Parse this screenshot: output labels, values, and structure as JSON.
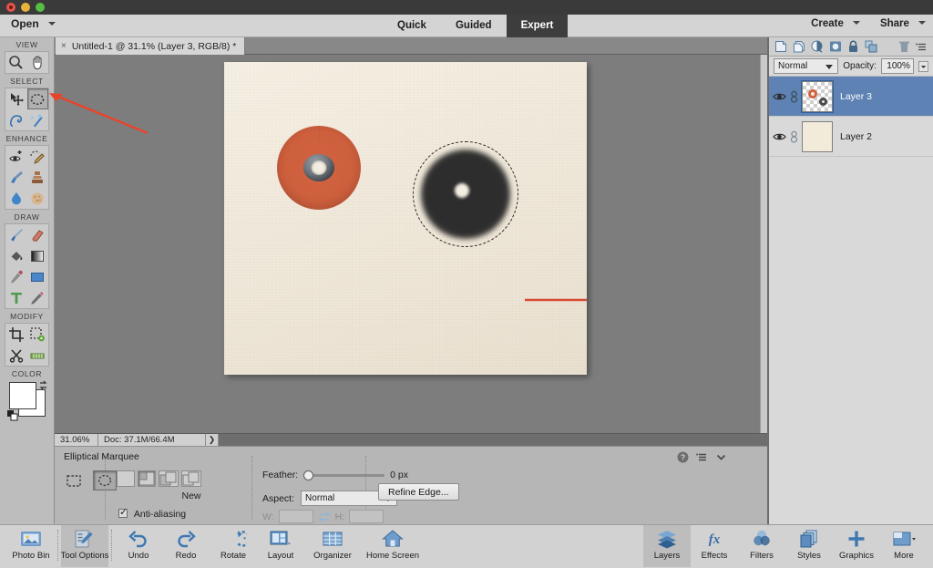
{
  "window": {
    "traffic_lights": [
      "close",
      "minimize",
      "maximize"
    ]
  },
  "menubar": {
    "open_label": "Open",
    "modes": [
      {
        "label": "Quick",
        "active": false
      },
      {
        "label": "Guided",
        "active": false
      },
      {
        "label": "Expert",
        "active": true
      }
    ],
    "right_menus": [
      {
        "label": "Create"
      },
      {
        "label": "Share"
      }
    ]
  },
  "document_tab": {
    "close_glyph": "×",
    "title": "Untitled-1 @ 31.1% (Layer 3, RGB/8) *"
  },
  "toolbar": {
    "groups": [
      {
        "label": "VIEW",
        "tools": [
          {
            "name": "zoom-tool",
            "icon": "magnifier-icon",
            "active": false
          },
          {
            "name": "hand-tool",
            "icon": "hand-icon",
            "active": false
          }
        ]
      },
      {
        "label": "SELECT",
        "tools": [
          {
            "name": "move-tool",
            "icon": "move-arrow-icon",
            "active": false
          },
          {
            "name": "elliptical-marquee-tool",
            "icon": "ellipse-marquee-icon",
            "active": true
          },
          {
            "name": "lasso-tool",
            "icon": "lasso-icon",
            "active": false
          },
          {
            "name": "quick-selection-tool",
            "icon": "magic-wand-icon",
            "active": false
          }
        ]
      },
      {
        "label": "ENHANCE",
        "tools": [
          {
            "name": "red-eye-tool",
            "icon": "eye-icon",
            "active": false
          },
          {
            "name": "spot-healing-tool",
            "icon": "healing-brush-icon",
            "active": false
          },
          {
            "name": "smart-brush-tool",
            "icon": "paintbrush-blue-icon",
            "active": false
          },
          {
            "name": "clone-stamp-tool",
            "icon": "stamp-icon",
            "active": false
          },
          {
            "name": "blur-tool",
            "icon": "waterdrop-icon",
            "active": false
          },
          {
            "name": "sponge-tool",
            "icon": "sponge-icon",
            "active": false
          }
        ]
      },
      {
        "label": "DRAW",
        "tools": [
          {
            "name": "brush-tool",
            "icon": "brush-icon",
            "active": false
          },
          {
            "name": "eraser-tool",
            "icon": "eraser-icon",
            "active": false
          },
          {
            "name": "paint-bucket-tool",
            "icon": "paint-bucket-icon",
            "active": false
          },
          {
            "name": "gradient-tool",
            "icon": "gradient-icon",
            "active": false
          },
          {
            "name": "eyedropper-tool",
            "icon": "eyedropper-icon",
            "active": false
          },
          {
            "name": "shape-tool",
            "icon": "rectangle-shape-icon",
            "active": false
          },
          {
            "name": "type-tool",
            "icon": "type-t-icon",
            "active": false
          },
          {
            "name": "pencil-tool",
            "icon": "pencil-icon",
            "active": false
          }
        ]
      },
      {
        "label": "MODIFY",
        "tools": [
          {
            "name": "crop-tool",
            "icon": "crop-icon",
            "active": false
          },
          {
            "name": "content-aware-move-tool",
            "icon": "cookie-cutter-icon",
            "active": false
          },
          {
            "name": "recompose-tool",
            "icon": "scissors-icon",
            "active": false
          },
          {
            "name": "straighten-tool",
            "icon": "straighten-icon",
            "active": false
          }
        ]
      },
      {
        "label": "COLOR",
        "tools": []
      }
    ],
    "color": {
      "foreground": "#ffffff",
      "background": "#ffffff",
      "swap_icon": "swap-colors-icon",
      "default_icon": "default-colors-icon"
    }
  },
  "canvas": {
    "background_color": "#7d7d7d",
    "paper_color": "#f2ece0",
    "objects": [
      {
        "name": "orange-disc",
        "color": "#d2613f",
        "description": "orange felt disc with metal grommet"
      },
      {
        "name": "dark-blurred-disc",
        "color": "#2d2d2d",
        "description": "blurred dark circle with light center"
      },
      {
        "name": "elliptical-selection",
        "description": "marching ants elliptical selection"
      }
    ],
    "annotations": [
      {
        "name": "canvas-red-arrow",
        "color": "#d94a34",
        "points_to": "dark-blurred-disc"
      },
      {
        "name": "toolbar-red-arrow",
        "color": "#e8442c",
        "points_to": "elliptical-marquee-tool"
      }
    ]
  },
  "statusbar": {
    "zoom": "31.06%",
    "doc_info": "Doc: 37.1M/66.4M",
    "expand_glyph": "❯"
  },
  "tool_options": {
    "title": "Elliptical Marquee",
    "shape_buttons": [
      {
        "name": "rectangular-marquee",
        "icon": "rect-marquee-icon",
        "active": false
      },
      {
        "name": "elliptical-marquee",
        "icon": "ellipse-marquee-icon",
        "active": true
      }
    ],
    "mode_buttons": [
      {
        "name": "new-selection",
        "active": false
      },
      {
        "name": "add-to-selection",
        "active": true
      },
      {
        "name": "subtract-from-selection",
        "active": false
      },
      {
        "name": "intersect-with-selection",
        "active": false
      }
    ],
    "mode_label": "New",
    "antialias_label": "Anti-aliasing",
    "antialias_checked": true,
    "feather_label": "Feather:",
    "feather_value": "0 px",
    "aspect_label": "Aspect:",
    "aspect_value": "Normal",
    "width_label": "W:",
    "width_value": "",
    "height_label": "H:",
    "height_value": "",
    "refine_edge_label": "Refine Edge...",
    "help_icon": "help-question-icon",
    "panel_menu_icon": "panel-menu-icon",
    "collapse_icon": "chevron-down-icon"
  },
  "layers_panel": {
    "toolbar_icons": [
      {
        "name": "new-layer-icon"
      },
      {
        "name": "duplicate-layer-icon"
      },
      {
        "name": "adjustment-layer-icon"
      },
      {
        "name": "layer-mask-icon"
      },
      {
        "name": "lock-layer-icon"
      },
      {
        "name": "link-layers-icon"
      },
      {
        "name": "delete-layer-icon"
      },
      {
        "name": "panel-menu-icon"
      }
    ],
    "blend_mode": "Normal",
    "opacity_label": "Opacity:",
    "opacity_value": "100%",
    "layers": [
      {
        "name": "Layer 3",
        "visible": true,
        "selected": true,
        "thumb": "transparent"
      },
      {
        "name": "Layer 2",
        "visible": true,
        "selected": false,
        "thumb": "cream"
      }
    ],
    "selection_color": "#5d82b3"
  },
  "taskbar": {
    "left_items": [
      {
        "label": "Photo Bin",
        "icon": "photo-bin-icon",
        "active": false
      },
      {
        "label": "Tool Options",
        "icon": "tool-options-icon",
        "active": true
      },
      {
        "label": "Undo",
        "icon": "undo-arrow-icon",
        "active": false
      },
      {
        "label": "Redo",
        "icon": "redo-arrow-icon",
        "active": false
      },
      {
        "label": "Rotate",
        "icon": "rotate-icon",
        "active": false
      },
      {
        "label": "Layout",
        "icon": "layout-icon",
        "active": false
      },
      {
        "label": "Organizer",
        "icon": "organizer-grid-icon",
        "active": false
      },
      {
        "label": "Home Screen",
        "icon": "home-icon",
        "active": false
      }
    ],
    "right_items": [
      {
        "label": "Layers",
        "icon": "layers-stack-icon",
        "active": true
      },
      {
        "label": "Effects",
        "icon": "fx-icon",
        "active": false
      },
      {
        "label": "Filters",
        "icon": "filters-circles-icon",
        "active": false
      },
      {
        "label": "Styles",
        "icon": "styles-icon",
        "active": false
      },
      {
        "label": "Graphics",
        "icon": "plus-icon",
        "active": false
      },
      {
        "label": "More",
        "icon": "more-panel-icon",
        "active": false
      }
    ]
  }
}
